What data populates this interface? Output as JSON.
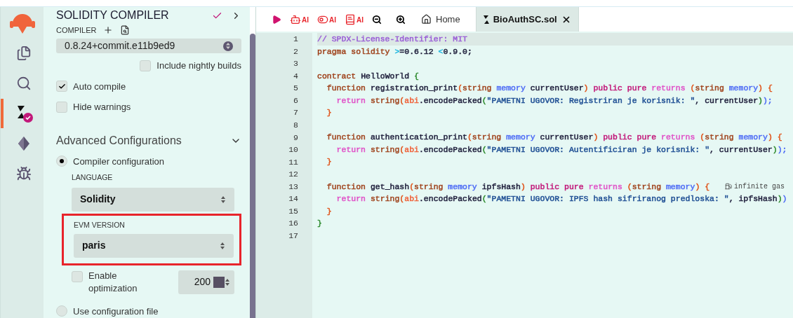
{
  "icon_bar": {
    "items": [
      {
        "kind": "files",
        "selected": false
      },
      {
        "kind": "search",
        "selected": false
      },
      {
        "kind": "compiler",
        "selected": true
      },
      {
        "kind": "deploy",
        "selected": false
      },
      {
        "kind": "debug",
        "selected": false
      }
    ]
  },
  "panel": {
    "title": "SOLIDITY COMPILER",
    "compiler_label": "COMPILER",
    "compiler_version": "0.8.24+commit.e11b9ed9",
    "options": [
      {
        "label": "Include nightly builds",
        "checked": false
      },
      {
        "label": "Auto compile",
        "checked": true
      },
      {
        "label": "Hide warnings",
        "checked": false
      }
    ],
    "advanced_title": "Advanced Configurations",
    "expanded": true,
    "config_sources": [
      {
        "label": "Compiler configuration",
        "selected": true
      },
      {
        "label": "Use configuration file",
        "selected": false
      }
    ],
    "language_label": "LANGUAGE",
    "language": "Solidity",
    "evm_label": "EVM VERSION",
    "evm_version": "paris",
    "evm_highlighted": true,
    "optimization": {
      "label": "Enable optimization",
      "checked": false,
      "runs": "200"
    }
  },
  "toolbar": {
    "ai_buttons": [
      {
        "kind": "robot",
        "label": "AI"
      },
      {
        "kind": "toggle",
        "label": "AI"
      },
      {
        "kind": "book",
        "label": "AI"
      }
    ],
    "tabs": [
      {
        "label": "Home",
        "kind": "home",
        "selected": false
      },
      {
        "label": "BioAuthSC.sol",
        "kind": "file",
        "selected": true
      }
    ]
  },
  "editor": {
    "lines": [
      {
        "number": "1",
        "tokens": [
          {
            "text": "// SPDX-License-Identifier: MIT",
            "color": "#9a5fd6"
          }
        ]
      },
      {
        "number": "2",
        "tokens": [
          {
            "text": "pragma solidity ",
            "color": "#a0451f"
          },
          {
            "text": ">",
            "color": "#22b8e0"
          },
          {
            "text": "=0.6.12 ",
            "color": "#1d1d3a"
          },
          {
            "text": "<",
            "color": "#22b8e0"
          },
          {
            "text": "0.9.0;",
            "color": "#1d1d3a"
          }
        ]
      },
      {
        "number": "3"
      },
      {
        "number": "4",
        "tokens": [
          {
            "text": "contract ",
            "color": "#a0451f"
          },
          {
            "text": "HelloWorld ",
            "color": "#1d1d3a"
          },
          {
            "text": "{",
            "color": "#2e8b2e"
          }
        ]
      },
      {
        "number": "5",
        "tokens": [
          {
            "text": "  function ",
            "color": "#a0451f"
          },
          {
            "text": "registration_print",
            "color": "#1d1d3a"
          },
          {
            "text": "(",
            "color": "#e0541a"
          },
          {
            "text": "string ",
            "color": "#a0451f"
          },
          {
            "text": "memory ",
            "color": "#4f6df5"
          },
          {
            "text": "currentUser",
            "color": "#1d1d3a"
          },
          {
            "text": ") ",
            "color": "#e0541a"
          },
          {
            "text": "public pure ",
            "color": "#c2187a"
          },
          {
            "text": "returns ",
            "color": "#e052c8"
          },
          {
            "text": "(",
            "color": "#e0541a"
          },
          {
            "text": "string ",
            "color": "#a0451f"
          },
          {
            "text": "memory",
            "color": "#4f6df5"
          },
          {
            "text": ") {",
            "color": "#e0541a"
          }
        ]
      },
      {
        "number": "6",
        "tokens": [
          {
            "text": "    return ",
            "color": "#e052c8"
          },
          {
            "text": "string",
            "color": "#a0451f"
          },
          {
            "text": "(",
            "color": "#e0541a"
          },
          {
            "text": "abi",
            "color": "#f0643c"
          },
          {
            "text": ".encodePacked",
            "color": "#1d1d3a"
          },
          {
            "text": "(",
            "color": "#2e8b2e"
          },
          {
            "text": "\"PAMETNI UGOVOR: Registriran je korisnik: \"",
            "color": "#1f4f94"
          },
          {
            "text": ", currentUser",
            "color": "#1d1d3a"
          },
          {
            "text": ")",
            "color": "#2e8b2e"
          },
          {
            "text": ");",
            "color": "#4f6df5"
          }
        ]
      },
      {
        "number": "7",
        "tokens": [
          {
            "text": "  }",
            "color": "#e0541a"
          }
        ]
      },
      {
        "number": "8"
      },
      {
        "number": "9",
        "tokens": [
          {
            "text": "  function ",
            "color": "#a0451f"
          },
          {
            "text": "authentication_print",
            "color": "#1d1d3a"
          },
          {
            "text": "(",
            "color": "#e0541a"
          },
          {
            "text": "string ",
            "color": "#a0451f"
          },
          {
            "text": "memory ",
            "color": "#4f6df5"
          },
          {
            "text": "currentUser",
            "color": "#1d1d3a"
          },
          {
            "text": ") ",
            "color": "#e0541a"
          },
          {
            "text": "public pure ",
            "color": "#c2187a"
          },
          {
            "text": "returns ",
            "color": "#e052c8"
          },
          {
            "text": "(",
            "color": "#e0541a"
          },
          {
            "text": "string ",
            "color": "#a0451f"
          },
          {
            "text": "memory",
            "color": "#4f6df5"
          },
          {
            "text": ") {",
            "color": "#e0541a"
          }
        ]
      },
      {
        "number": "10",
        "tokens": [
          {
            "text": "    return ",
            "color": "#e052c8"
          },
          {
            "text": "string",
            "color": "#a0451f"
          },
          {
            "text": "(",
            "color": "#e0541a"
          },
          {
            "text": "abi",
            "color": "#f0643c"
          },
          {
            "text": ".encodePacked",
            "color": "#1d1d3a"
          },
          {
            "text": "(",
            "color": "#2e8b2e"
          },
          {
            "text": "\"PAMETNI UGOVOR: Autentificiran je korisnik: \"",
            "color": "#1f4f94"
          },
          {
            "text": ", currentUser",
            "color": "#1d1d3a"
          },
          {
            "text": ")",
            "color": "#2e8b2e"
          },
          {
            "text": ");",
            "color": "#4f6df5"
          }
        ]
      },
      {
        "number": "11",
        "tokens": [
          {
            "text": "  }",
            "color": "#e0541a"
          }
        ]
      },
      {
        "number": "12"
      },
      {
        "number": "13",
        "tokens": [
          {
            "text": "  function ",
            "color": "#a0451f"
          },
          {
            "text": "get_hash",
            "color": "#1d1d3a"
          },
          {
            "text": "(",
            "color": "#e0541a"
          },
          {
            "text": "string ",
            "color": "#a0451f"
          },
          {
            "text": "memory ",
            "color": "#4f6df5"
          },
          {
            "text": "ipfsHash",
            "color": "#1d1d3a"
          },
          {
            "text": ") ",
            "color": "#e0541a"
          },
          {
            "text": "public pure ",
            "color": "#c2187a"
          },
          {
            "text": "returns ",
            "color": "#e052c8"
          },
          {
            "text": "(",
            "color": "#e0541a"
          },
          {
            "text": "string ",
            "color": "#a0451f"
          },
          {
            "text": "memory",
            "color": "#4f6df5"
          },
          {
            "text": ") {",
            "color": "#e0541a"
          }
        ],
        "hint": "infinite gas"
      },
      {
        "number": "14",
        "tokens": [
          {
            "text": "    return ",
            "color": "#e052c8"
          },
          {
            "text": "string",
            "color": "#a0451f"
          },
          {
            "text": "(",
            "color": "#e0541a"
          },
          {
            "text": "abi",
            "color": "#f0643c"
          },
          {
            "text": ".encodePacked",
            "color": "#1d1d3a"
          },
          {
            "text": "(",
            "color": "#2e8b2e"
          },
          {
            "text": "\"PAMETNI UGOVOR: IPFS hash sifriranog predloska: \"",
            "color": "#1f4f94"
          },
          {
            "text": ", ipfsHash",
            "color": "#1d1d3a"
          },
          {
            "text": ")",
            "color": "#2e8b2e"
          },
          {
            "text": ")",
            "color": "#4f6df5"
          }
        ]
      },
      {
        "number": "15",
        "tokens": [
          {
            "text": "  }",
            "color": "#e0541a"
          }
        ]
      },
      {
        "number": "16",
        "tokens": [
          {
            "text": "}",
            "color": "#2e8b2e"
          }
        ]
      },
      {
        "number": "17"
      }
    ]
  }
}
